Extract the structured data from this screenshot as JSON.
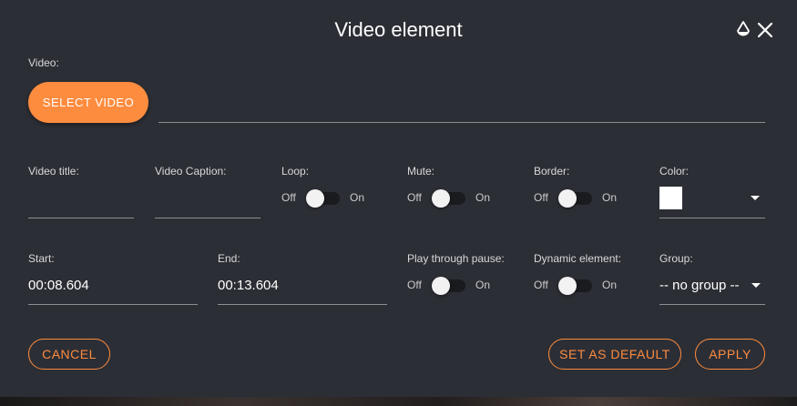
{
  "dialog": {
    "title": "Video element",
    "icons": {
      "theme": "drop-icon",
      "close": "close-icon"
    }
  },
  "video": {
    "label": "Video:",
    "select_button": "SELECT VIDEO",
    "file_value": ""
  },
  "fields": {
    "video_title": {
      "label": "Video title:",
      "value": ""
    },
    "video_caption": {
      "label": "Video Caption:",
      "value": ""
    },
    "start": {
      "label": "Start:",
      "value": "00:08.604"
    },
    "end": {
      "label": "End:",
      "value": "00:13.604"
    }
  },
  "toggles": {
    "loop": {
      "label": "Loop:",
      "off": "Off",
      "on": "On",
      "state": "off"
    },
    "mute": {
      "label": "Mute:",
      "off": "Off",
      "on": "On",
      "state": "off"
    },
    "border": {
      "label": "Border:",
      "off": "Off",
      "on": "On",
      "state": "off"
    },
    "play_through_pause": {
      "label": "Play through pause:",
      "off": "Off",
      "on": "On",
      "state": "off"
    },
    "dynamic_element": {
      "label": "Dynamic element:",
      "off": "Off",
      "on": "On",
      "state": "off"
    }
  },
  "color": {
    "label": "Color:",
    "value": "#ffffff"
  },
  "group": {
    "label": "Group:",
    "value": "-- no group --"
  },
  "buttons": {
    "cancel": "CANCEL",
    "set_default": "SET AS DEFAULT",
    "apply": "APPLY"
  },
  "theme": {
    "background": "#2c2e35",
    "accent": "#fd8c3f",
    "text": "#ffffff",
    "label": "#d7d8db"
  }
}
